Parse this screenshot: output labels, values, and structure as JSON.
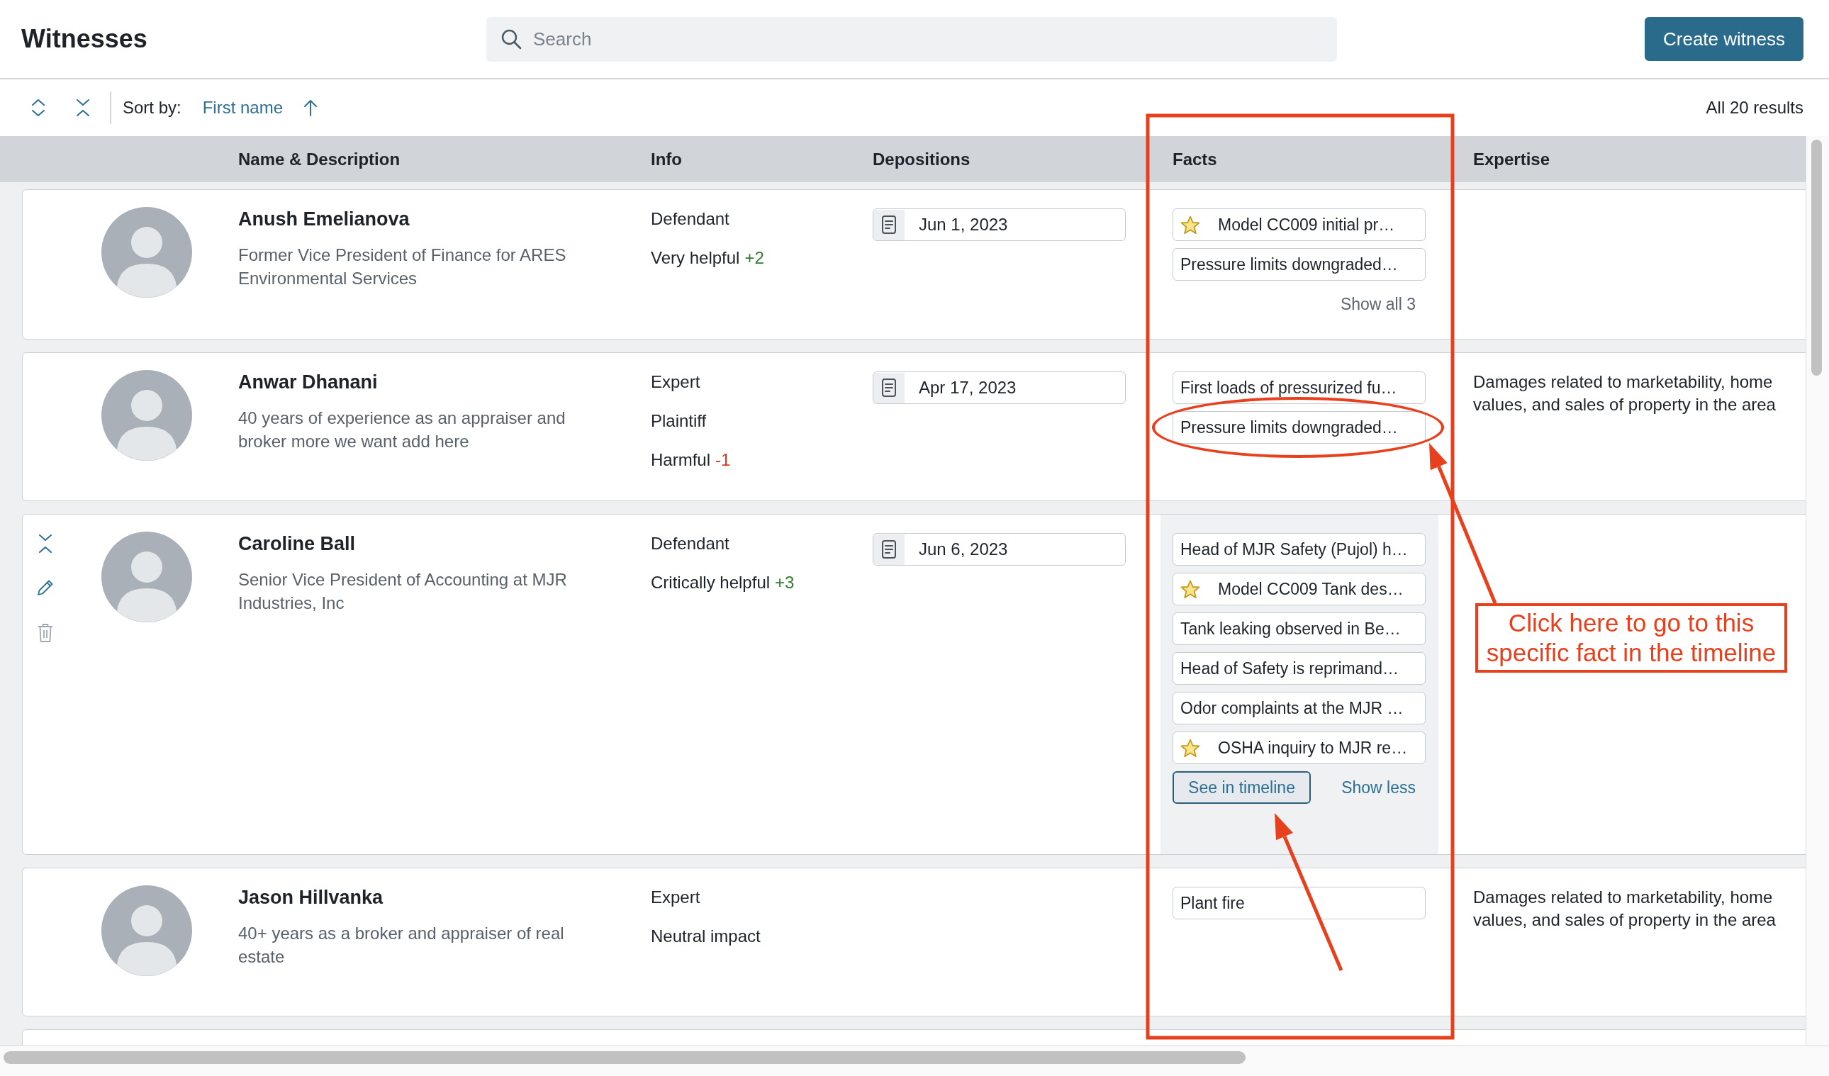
{
  "header": {
    "title": "Witnesses",
    "search": {
      "placeholder": "Search"
    },
    "create_button": "Create witness"
  },
  "toolbar": {
    "sort_label": "Sort by:",
    "sort_field": "First name",
    "sort_ascending": true,
    "results": "All 20 results"
  },
  "table": {
    "columns": [
      "Name & Description",
      "Info",
      "Depositions",
      "Facts",
      "Expertise"
    ],
    "rows": [
      {
        "name": "Anush Emelianova",
        "description": "Former Vice President of Finance for ARES Environmental Services",
        "expanded": false,
        "info": [
          {
            "kind": "role",
            "text": "Defendant"
          },
          {
            "kind": "rating",
            "text": "Very helpful",
            "score": "+2",
            "color": "#2e7d32"
          }
        ],
        "depositions": [
          "Jun 1, 2023"
        ],
        "facts": [
          {
            "text": "Model CC009 initial pr…",
            "starred": true,
            "circled": false
          },
          {
            "text": "Pressure limits downgraded…",
            "starred": false,
            "circled": false
          }
        ],
        "facts_link": "Show all 3"
      },
      {
        "name": "Anwar Dhanani",
        "description": "40 years of experience as an appraiser and broker more we want add here",
        "expanded": false,
        "info": [
          {
            "kind": "role",
            "text": "Expert"
          },
          {
            "kind": "role",
            "text": "Plaintiff"
          },
          {
            "kind": "rating",
            "text": "Harmful",
            "score": "-1",
            "color": "#d63a1e"
          }
        ],
        "depositions": [
          "Apr 17, 2023"
        ],
        "facts": [
          {
            "text": "First loads of pressurized fu…",
            "starred": false,
            "circled": false
          },
          {
            "text": "Pressure limits downgraded…",
            "starred": false,
            "circled": true
          }
        ],
        "expertise": "Damages related to marketability, home values, and sales of property in the area"
      },
      {
        "name": "Caroline Ball",
        "description": "Senior Vice President of Accounting at MJR Industries, Inc",
        "expanded": true,
        "info": [
          {
            "kind": "role",
            "text": "Defendant"
          },
          {
            "kind": "rating",
            "text": "Critically helpful",
            "score": "+3",
            "color": "#2e7d32"
          }
        ],
        "depositions": [
          "Jun 6, 2023"
        ],
        "facts": [
          {
            "text": "Head of MJR Safety (Pujol) h…",
            "starred": false,
            "circled": false
          },
          {
            "text": "Model CC009 Tank des…",
            "starred": true,
            "circled": false
          },
          {
            "text": "Tank leaking observed in Be…",
            "starred": false,
            "circled": false
          },
          {
            "text": "Head of Safety is reprimand…",
            "starred": false,
            "circled": false
          },
          {
            "text": "Odor complaints at the MJR …",
            "starred": false,
            "circled": false
          },
          {
            "text": "OSHA inquiry to MJR re…",
            "starred": true,
            "circled": false
          }
        ],
        "facts_button": "See in timeline",
        "facts_link": "Show less"
      },
      {
        "name": "Jason Hillvanka",
        "description": "40+ years as a broker and appraiser of real estate",
        "expanded": false,
        "info": [
          {
            "kind": "role",
            "text": "Expert"
          },
          {
            "kind": "rating",
            "text": "Neutral impact"
          }
        ],
        "facts": [
          {
            "text": "Plant fire",
            "starred": false,
            "circled": false
          }
        ],
        "expertise": "Damages related to marketability, home values, and sales of property in the area"
      }
    ]
  },
  "annotation": {
    "callout": "Click here to go to this specific fact in the timeline"
  }
}
